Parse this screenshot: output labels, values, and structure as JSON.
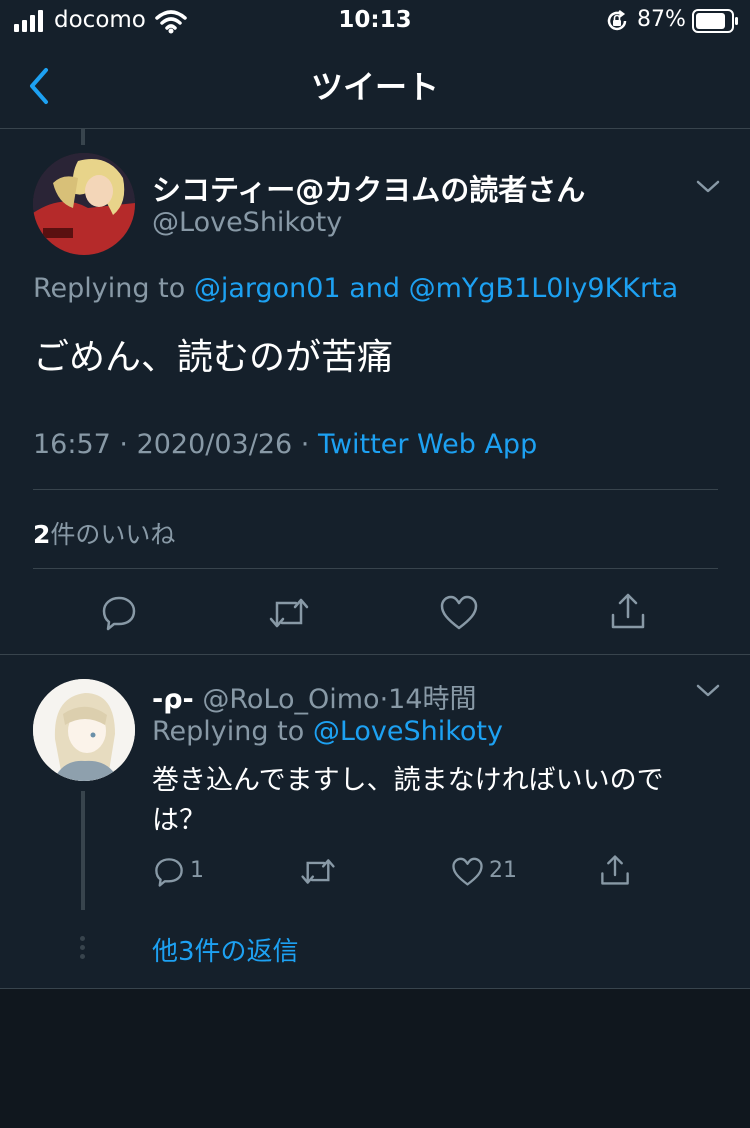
{
  "status_bar": {
    "carrier": "docomo",
    "time": "10:13",
    "battery_percent": "87%"
  },
  "nav": {
    "title": "ツイート"
  },
  "main_tweet": {
    "display_name": "シコティー@カクヨムの読者さん",
    "handle": "@LoveShikoty",
    "replying_prefix": "Replying to ",
    "replying_user1": "@jargon01",
    "replying_and": " and ",
    "replying_user2": "@mYgB1L0Iy9KKrta",
    "text": "ごめん、読むのが苦痛",
    "time": "16:57",
    "separator": " · ",
    "date": "2020/03/26",
    "source": "Twitter Web App",
    "likes_count": "2",
    "likes_label": "件のいいね"
  },
  "reply_tweet": {
    "display_name": "-ρ-",
    "handle": " @RoLo_Oimo",
    "time_ago": "·14時間",
    "replying_prefix": "Replying to ",
    "replying_user": "@LoveShikoty",
    "text": "巻き込んでますし、読まなければいいのでは？",
    "reply_count": "1",
    "like_count": "21",
    "more_replies": "他3件の返信"
  },
  "colors": {
    "background": "#15202b",
    "accent": "#1da1f2",
    "secondary_text": "#8899a6",
    "divider": "#38444d"
  }
}
